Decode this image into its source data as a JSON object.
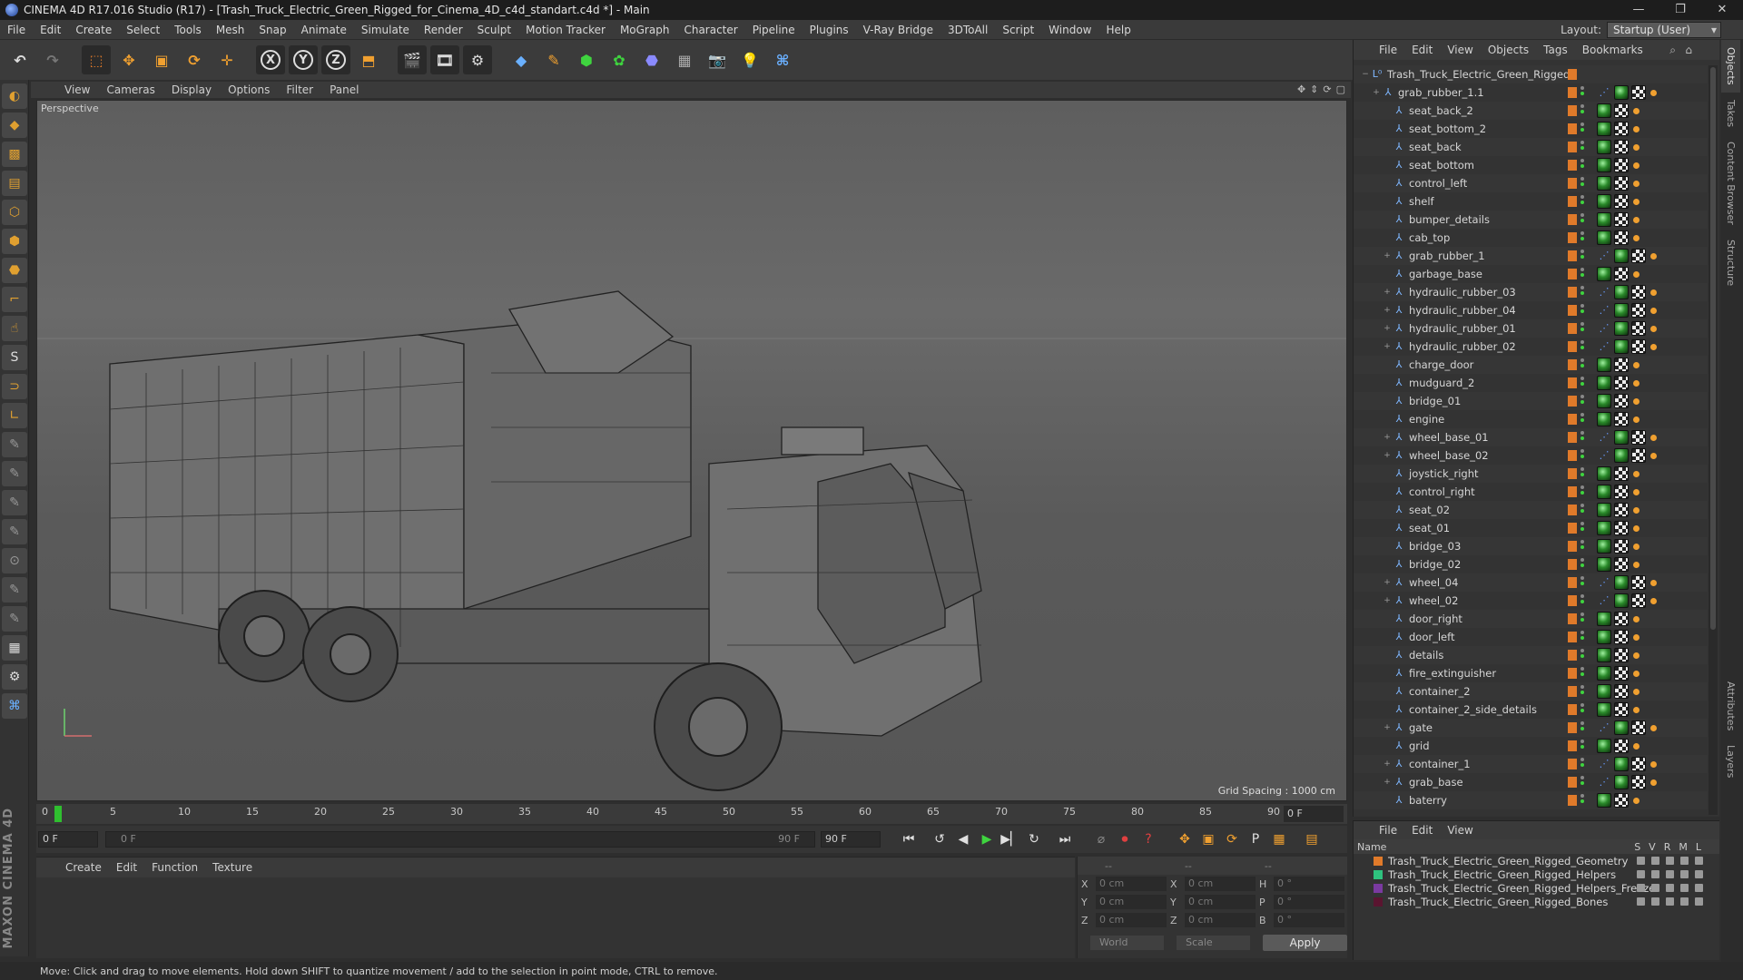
{
  "window": {
    "title": "CINEMA 4D R17.016 Studio (R17) - [Trash_Truck_Electric_Green_Rigged_for_Cinema_4D_c4d_standart.c4d *] - Main",
    "controls": [
      "—",
      "❐",
      "✕"
    ]
  },
  "menubar": {
    "items": [
      "File",
      "Edit",
      "Create",
      "Select",
      "Tools",
      "Mesh",
      "Snap",
      "Animate",
      "Simulate",
      "Render",
      "Sculpt",
      "Motion Tracker",
      "MoGraph",
      "Character",
      "Pipeline",
      "Plugins",
      "V-Ray Bridge",
      "3DToAll",
      "Script",
      "Window",
      "Help"
    ],
    "layout_label": "Layout:",
    "layout_value": "Startup (User)"
  },
  "toolbar": {
    "axis_x": "X",
    "axis_y": "Y",
    "axis_z": "Z"
  },
  "viewport": {
    "menu": [
      "View",
      "Cameras",
      "Display",
      "Options",
      "Filter",
      "Panel"
    ],
    "camera_label": "Perspective",
    "grid_spacing": "Grid Spacing : 1000 cm"
  },
  "timeline": {
    "ticks": [
      "0",
      "5",
      "10",
      "15",
      "20",
      "25",
      "30",
      "35",
      "40",
      "45",
      "50",
      "55",
      "60",
      "65",
      "70",
      "75",
      "80",
      "85",
      "90"
    ],
    "current_frame": "0 F"
  },
  "playback": {
    "start_frame": "0 F",
    "range_start": "0 F",
    "range_end": "90 F",
    "end_frame": "90 F"
  },
  "material_manager": {
    "menu": [
      "Create",
      "Edit",
      "Function",
      "Texture"
    ]
  },
  "coordinates": {
    "headers": [
      "--",
      "--",
      "--"
    ],
    "rows": [
      {
        "axis": "X",
        "pos": "0 cm",
        "size_axis": "X",
        "size": "0 cm",
        "rot_axis": "H",
        "rot": "0 °"
      },
      {
        "axis": "Y",
        "pos": "0 cm",
        "size_axis": "Y",
        "size": "0 cm",
        "rot_axis": "P",
        "rot": "0 °"
      },
      {
        "axis": "Z",
        "pos": "0 cm",
        "size_axis": "Z",
        "size": "0 cm",
        "rot_axis": "B",
        "rot": "0 °"
      }
    ],
    "space": "World",
    "mode": "Scale",
    "apply_label": "Apply"
  },
  "status": {
    "text": "Move: Click and drag to move elements. Hold down SHIFT to quantize movement / add to the selection in point mode, CTRL to remove."
  },
  "object_manager": {
    "menu": [
      "File",
      "Edit",
      "View",
      "Objects",
      "Tags",
      "Bookmarks"
    ],
    "root": "Trash_Truck_Electric_Green_Rigged",
    "objects": [
      {
        "name": "grab_rubber_1.1",
        "indent": 1,
        "expand": "+"
      },
      {
        "name": "seat_back_2",
        "indent": 2,
        "expand": ""
      },
      {
        "name": "seat_bottom_2",
        "indent": 2,
        "expand": ""
      },
      {
        "name": "seat_back",
        "indent": 2,
        "expand": ""
      },
      {
        "name": "seat_bottom",
        "indent": 2,
        "expand": ""
      },
      {
        "name": "control_left",
        "indent": 2,
        "expand": ""
      },
      {
        "name": "shelf",
        "indent": 2,
        "expand": ""
      },
      {
        "name": "bumper_details",
        "indent": 2,
        "expand": ""
      },
      {
        "name": "cab_top",
        "indent": 2,
        "expand": ""
      },
      {
        "name": "grab_rubber_1",
        "indent": 2,
        "expand": "+"
      },
      {
        "name": "garbage_base",
        "indent": 2,
        "expand": ""
      },
      {
        "name": "hydraulic_rubber_03",
        "indent": 2,
        "expand": "+"
      },
      {
        "name": "hydraulic_rubber_04",
        "indent": 2,
        "expand": "+"
      },
      {
        "name": "hydraulic_rubber_01",
        "indent": 2,
        "expand": "+"
      },
      {
        "name": "hydraulic_rubber_02",
        "indent": 2,
        "expand": "+"
      },
      {
        "name": "charge_door",
        "indent": 2,
        "expand": ""
      },
      {
        "name": "mudguard_2",
        "indent": 2,
        "expand": ""
      },
      {
        "name": "bridge_01",
        "indent": 2,
        "expand": ""
      },
      {
        "name": "engine",
        "indent": 2,
        "expand": ""
      },
      {
        "name": "wheel_base_01",
        "indent": 2,
        "expand": "+"
      },
      {
        "name": "wheel_base_02",
        "indent": 2,
        "expand": "+"
      },
      {
        "name": "joystick_right",
        "indent": 2,
        "expand": ""
      },
      {
        "name": "control_right",
        "indent": 2,
        "expand": ""
      },
      {
        "name": "seat_02",
        "indent": 2,
        "expand": ""
      },
      {
        "name": "seat_01",
        "indent": 2,
        "expand": ""
      },
      {
        "name": "bridge_03",
        "indent": 2,
        "expand": ""
      },
      {
        "name": "bridge_02",
        "indent": 2,
        "expand": ""
      },
      {
        "name": "wheel_04",
        "indent": 2,
        "expand": "+"
      },
      {
        "name": "wheel_02",
        "indent": 2,
        "expand": "+"
      },
      {
        "name": "door_right",
        "indent": 2,
        "expand": ""
      },
      {
        "name": "door_left",
        "indent": 2,
        "expand": ""
      },
      {
        "name": "details",
        "indent": 2,
        "expand": ""
      },
      {
        "name": "fire_extinguisher",
        "indent": 2,
        "expand": ""
      },
      {
        "name": "container_2",
        "indent": 2,
        "expand": ""
      },
      {
        "name": "container_2_side_details",
        "indent": 2,
        "expand": ""
      },
      {
        "name": "gate",
        "indent": 2,
        "expand": "+"
      },
      {
        "name": "grid",
        "indent": 2,
        "expand": ""
      },
      {
        "name": "container_1",
        "indent": 2,
        "expand": "+"
      },
      {
        "name": "grab_base",
        "indent": 2,
        "expand": "+"
      },
      {
        "name": "baterry",
        "indent": 2,
        "expand": ""
      }
    ]
  },
  "layer_manager": {
    "menu": [
      "File",
      "Edit",
      "View"
    ],
    "header_name": "Name",
    "header_cols": [
      "S",
      "V",
      "R",
      "M",
      "L"
    ],
    "layers": [
      {
        "name": "Trash_Truck_Electric_Green_Rigged_Geometry",
        "color": "#e07a2a"
      },
      {
        "name": "Trash_Truck_Electric_Green_Rigged_Helpers",
        "color": "#2ec27e"
      },
      {
        "name": "Trash_Truck_Electric_Green_Rigged_Helpers_Freeze",
        "color": "#7a3aa0"
      },
      {
        "name": "Trash_Truck_Electric_Green_Rigged_Bones",
        "color": "#5a1530"
      }
    ]
  },
  "side_tabs": [
    "Objects",
    "Takes",
    "Content Browser",
    "Structure",
    "Attributes",
    "Layers"
  ],
  "brand": "MAXON CINEMA 4D",
  "colors": {
    "accent_orange": "#e07a2a",
    "play_green": "#3fd43f",
    "record_red": "#e04040"
  }
}
